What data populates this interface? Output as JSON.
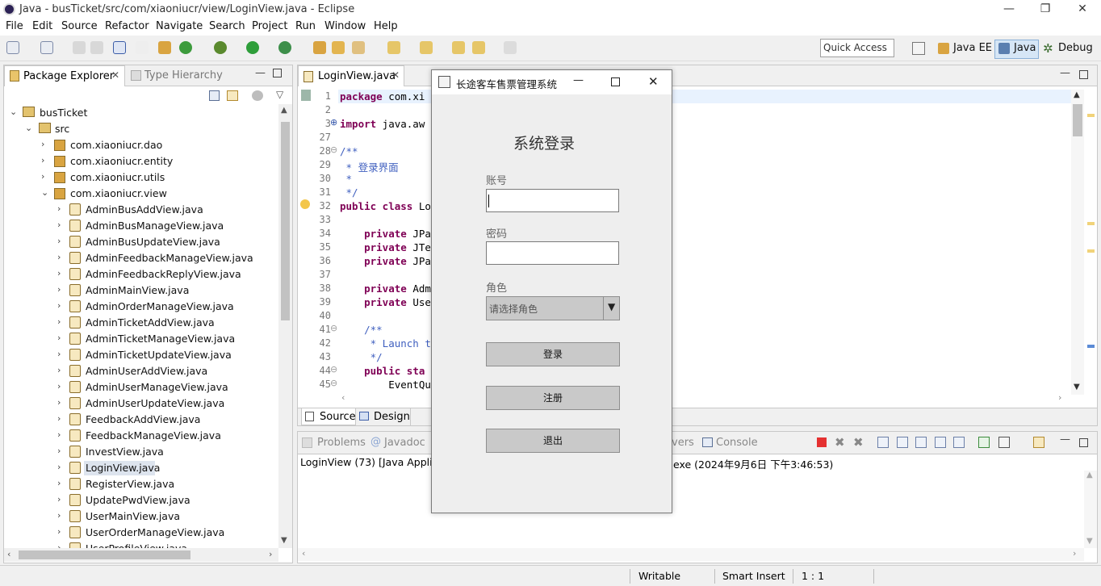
{
  "window": {
    "title": "Java - busTicket/src/com/xiaoniucr/view/LoginView.java - Eclipse"
  },
  "menu": [
    "File",
    "Edit",
    "Source",
    "Refactor",
    "Navigate",
    "Search",
    "Project",
    "Run",
    "Window",
    "Help"
  ],
  "toolbar": {
    "quick_access": "Quick Access",
    "perspectives": [
      "Java EE",
      "Java",
      "Debug"
    ]
  },
  "package_explorer": {
    "tab_label": "Package Explorer",
    "other_tab": "Type Hierarchy",
    "project": "busTicket",
    "src": "src",
    "packages": [
      "com.xiaoniucr.dao",
      "com.xiaoniucr.entity",
      "com.xiaoniucr.utils",
      "com.xiaoniucr.view"
    ],
    "files": [
      "AdminBusAddView.java",
      "AdminBusManageView.java",
      "AdminBusUpdateView.java",
      "AdminFeedbackManageView.java",
      "AdminFeedbackReplyView.java",
      "AdminMainView.java",
      "AdminOrderManageView.java",
      "AdminTicketAddView.java",
      "AdminTicketManageView.java",
      "AdminTicketUpdateView.java",
      "AdminUserAddView.java",
      "AdminUserManageView.java",
      "AdminUserUpdateView.java",
      "FeedbackAddView.java",
      "FeedbackManageView.java",
      "InvestView.java",
      "LoginView.java",
      "RegisterView.java",
      "UpdatePwdView.java",
      "UserMainView.java",
      "UserOrderManageView.java",
      "UserProfileView.java"
    ]
  },
  "editor": {
    "tab_label": "LoginView.java",
    "lines": [
      {
        "n": "1",
        "text": "package com.xi"
      },
      {
        "n": "2",
        "text": ""
      },
      {
        "n": "3",
        "text": "import java.aw"
      },
      {
        "n": "27",
        "text": ""
      },
      {
        "n": "28",
        "text": "/**"
      },
      {
        "n": "29",
        "text": " * 登录界面"
      },
      {
        "n": "30",
        "text": " *"
      },
      {
        "n": "31",
        "text": " */"
      },
      {
        "n": "32",
        "text": "public class Lo"
      },
      {
        "n": "33",
        "text": ""
      },
      {
        "n": "34",
        "text": "    private JPa"
      },
      {
        "n": "35",
        "text": "    private JTe"
      },
      {
        "n": "36",
        "text": "    private JPa"
      },
      {
        "n": "37",
        "text": ""
      },
      {
        "n": "38",
        "text": "    private Adm"
      },
      {
        "n": "39",
        "text": "    private Use"
      },
      {
        "n": "40",
        "text": ""
      },
      {
        "n": "41",
        "text": "    /**"
      },
      {
        "n": "42",
        "text": "     * Launch t"
      },
      {
        "n": "43",
        "text": "     */"
      },
      {
        "n": "44",
        "text": "    public sta"
      },
      {
        "n": "45",
        "text": "        EventQu"
      }
    ],
    "bottom_tabs": [
      "Source",
      "Design"
    ]
  },
  "console": {
    "tabs": [
      "Problems",
      "Javadoc",
      "vers",
      "Console"
    ],
    "line_left": "LoginView (73) [Java Applica",
    "line_right": "exe (2024年9月6日 下午3:46:53)"
  },
  "dialog": {
    "title": "长途客车售票管理系统",
    "heading": "系统登录",
    "account_label": "账号",
    "password_label": "密码",
    "role_label": "角色",
    "role_placeholder": "请选择角色",
    "login_button": "登录",
    "register_button": "注册",
    "exit_button": "退出"
  },
  "status": {
    "writable": "Writable",
    "insert": "Smart Insert",
    "position": "1 : 1"
  }
}
